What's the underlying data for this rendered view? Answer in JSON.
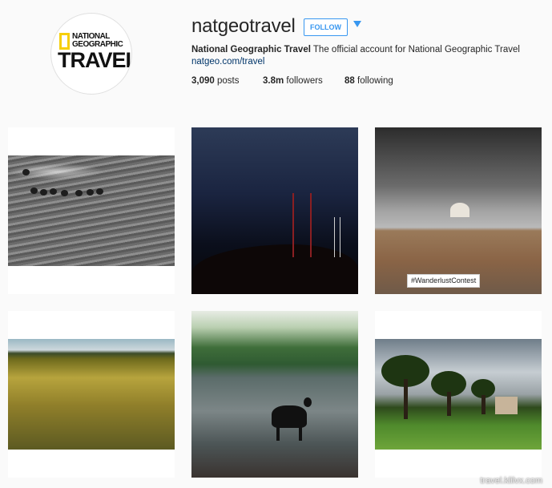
{
  "profile": {
    "avatar_top": "NATIONAL",
    "avatar_mid": "GEOGRAPHIC",
    "avatar_bottom": "TRAVEL",
    "username": "natgeotravel",
    "follow_label": "FOLLOW",
    "full_name": "National Geographic Travel",
    "bio": "The official account for National Geographic Travel",
    "website": "natgeo.com/travel"
  },
  "stats": {
    "posts_count": "3,090",
    "posts_label": "posts",
    "followers_count": "3.8m",
    "followers_label": "followers",
    "following_count": "88",
    "following_label": "following"
  },
  "grid": {
    "tiles": [
      {
        "label": "b/w field photo"
      },
      {
        "label": "night headframe photo"
      },
      {
        "label": "taj mahal photo"
      },
      {
        "label": "wheat field photo"
      },
      {
        "label": "dog at lake photo"
      },
      {
        "label": "trees in park photo"
      }
    ],
    "hashtag": "#WanderlustContest"
  },
  "colors": {
    "accent": "#3897f0",
    "background": "#fafafa"
  },
  "watermark": "travel.klilvx.com"
}
